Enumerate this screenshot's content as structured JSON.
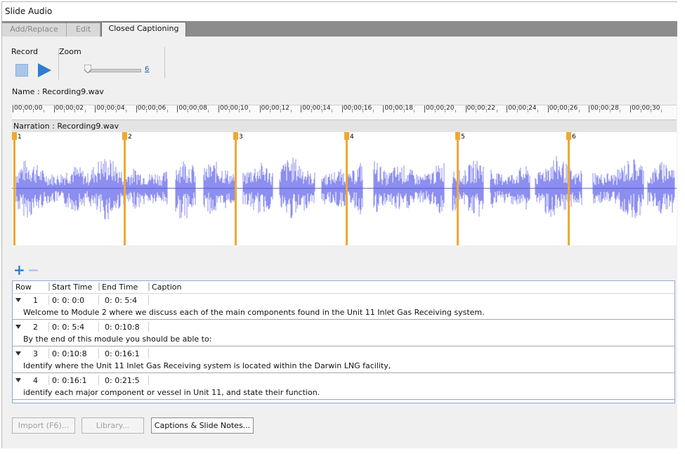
{
  "window": {
    "title": "Slide Audio"
  },
  "tabs": [
    {
      "label": "Add/Replace",
      "active": false
    },
    {
      "label": "Edit",
      "active": false
    },
    {
      "label": "Closed Captioning",
      "active": true
    }
  ],
  "record": {
    "label": "Record"
  },
  "zoom": {
    "label": "Zoom",
    "value": "6"
  },
  "name_row": {
    "label": "Name :",
    "value": "Recording9.wav"
  },
  "ruler": {
    "ticks": [
      "00:00:00",
      "00:00:02",
      "00:00:04",
      "00:00:06",
      "00:00:08",
      "00:00:10",
      "00:00:12",
      "00:00:14",
      "00:00:16",
      "00:00:18",
      "00:00:20",
      "00:00:22",
      "00:00:24",
      "00:00:26",
      "00:00:28",
      "00:00:30"
    ]
  },
  "narration": {
    "label": "Narration : Recording9.wav"
  },
  "markers": [
    "1",
    "2",
    "3",
    "4",
    "5",
    "6"
  ],
  "caption_table": {
    "headers": {
      "row": "Row",
      "start": "Start Time",
      "end": "End Time",
      "caption": "Caption"
    },
    "rows": [
      {
        "row": "1",
        "start": "0: 0: 0:0",
        "end": "0: 0: 5:4",
        "caption": "Welcome to Module 2 where we discuss each of the main components found in the Unit 11 Inlet Gas Receiving system."
      },
      {
        "row": "2",
        "start": "0: 0: 5:4",
        "end": "0: 0:10:8",
        "caption": "By the end of this module you should be able to:"
      },
      {
        "row": "3",
        "start": "0: 0:10:8",
        "end": "0: 0:16:1",
        "caption": "Identify where the Unit 11 Inlet Gas Receiving system is located within the Darwin LNG facility,"
      },
      {
        "row": "4",
        "start": "0: 0:16:1",
        "end": "0: 0:21:5",
        "caption": "identify each major component or vessel in Unit 11, and state their function."
      }
    ]
  },
  "buttons": {
    "import": "Import (F6)...",
    "library": "Library...",
    "captions": "Captions & Slide Notes..."
  },
  "colors": {
    "waveform": "#8c8ef0",
    "marker": "#f0a830",
    "accent": "#2f7bd1"
  }
}
